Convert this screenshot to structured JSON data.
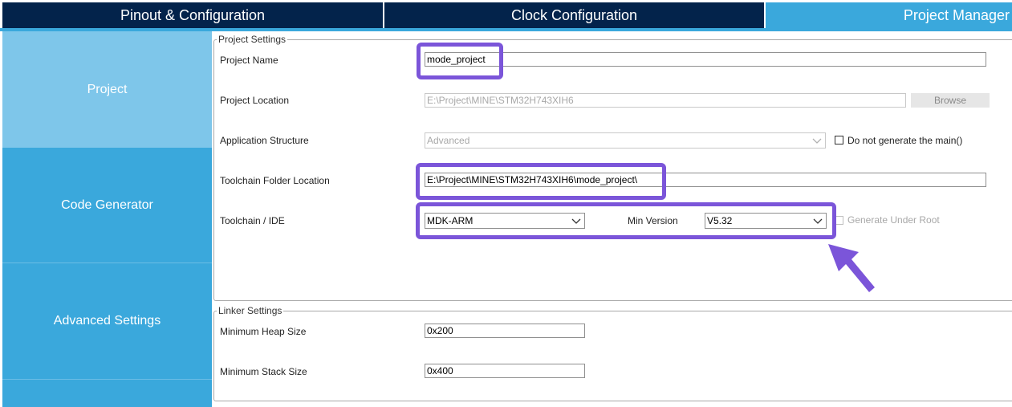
{
  "tabs": [
    {
      "label": "Pinout & Configuration"
    },
    {
      "label": "Clock Configuration"
    },
    {
      "label": "Project Manager"
    }
  ],
  "sidebar": {
    "items": [
      {
        "label": "Project"
      },
      {
        "label": "Code Generator"
      },
      {
        "label": "Advanced Settings"
      }
    ]
  },
  "project_settings": {
    "legend": "Project Settings",
    "project_name": {
      "label": "Project Name",
      "value": "mode_project"
    },
    "project_location": {
      "label": "Project Location",
      "value": "E:\\Project\\MINE\\STM32H743XIH6",
      "browse_label": "Browse"
    },
    "application_structure": {
      "label": "Application Structure",
      "value": "Advanced",
      "checkbox_label": "Do not generate the main()"
    },
    "toolchain_folder": {
      "label": "Toolchain Folder Location",
      "value": "E:\\Project\\MINE\\STM32H743XIH6\\mode_project\\"
    },
    "toolchain_ide": {
      "label": "Toolchain / IDE",
      "value": "MDK-ARM",
      "min_version_label": "Min Version",
      "min_version_value": "V5.32",
      "generate_root_label": "Generate Under Root"
    }
  },
  "linker_settings": {
    "legend": "Linker Settings",
    "heap": {
      "label": "Minimum Heap Size",
      "value": "0x200"
    },
    "stack": {
      "label": "Minimum Stack Size",
      "value": "0x400"
    }
  },
  "colors": {
    "tab_dark": "#03234b",
    "accent_blue": "#3aa8dc",
    "sidebar_active": "#7ec6ea",
    "highlight": "#7b55d9"
  }
}
